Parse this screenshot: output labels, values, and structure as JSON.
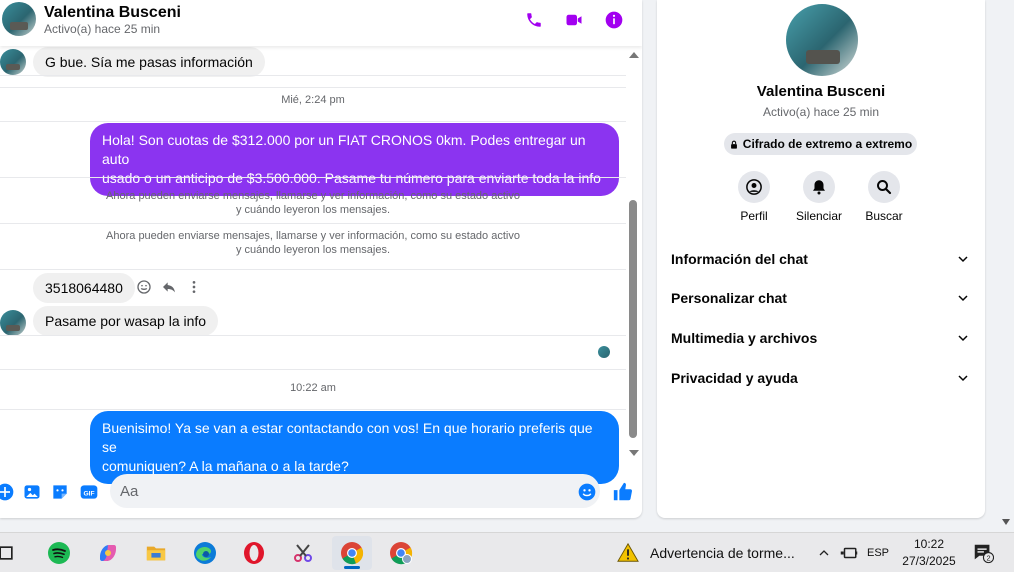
{
  "header": {
    "name": "Valentina Busceni",
    "status": "Activo(a) hace 25 min",
    "accent": "#a200f0"
  },
  "messages": {
    "msg1": "G bue. Sía me pasas información",
    "ts1": "Mié, 2:24 pm",
    "msg2_line1": "Hola! Son cuotas de $312.000 por un FIAT CRONOS 0km. Podes entregar un auto",
    "msg2_line2": "usado o un anticipo de $3.500.000. Pasame tu número para enviarte toda la info",
    "sys_line1": "Ahora pueden enviarse mensajes, llamarse y ver información, como su estado activo",
    "sys_line2": "y cuándo leyeron los mensajes.",
    "msg3": "3518064480",
    "msg4": "Pasame por wasap   la info",
    "ts2": "10:22 am",
    "msg5_line1": "Buenisimo! Ya se van a estar contactando con vos! En que horario preferis que se",
    "msg5_line2": "comuniquen? A la mañana o a la tarde?",
    "purple": "#8b34f0",
    "blue": "#0a7cff"
  },
  "composer": {
    "placeholder": "Aa"
  },
  "info": {
    "name": "Valentina Busceni",
    "status": "Activo(a) hace 25 min",
    "encryption": "Cifrado de extremo a extremo",
    "actions": [
      "Perfil",
      "Silenciar",
      "Buscar"
    ],
    "sections": [
      "Información del chat",
      "Personalizar chat",
      "Multimedia y archivos",
      "Privacidad y ayuda"
    ]
  },
  "taskbar": {
    "weather": "Advertencia de torme...",
    "lang": "ESP",
    "time": "10:22",
    "date": "27/3/2025",
    "notifications": "2"
  }
}
